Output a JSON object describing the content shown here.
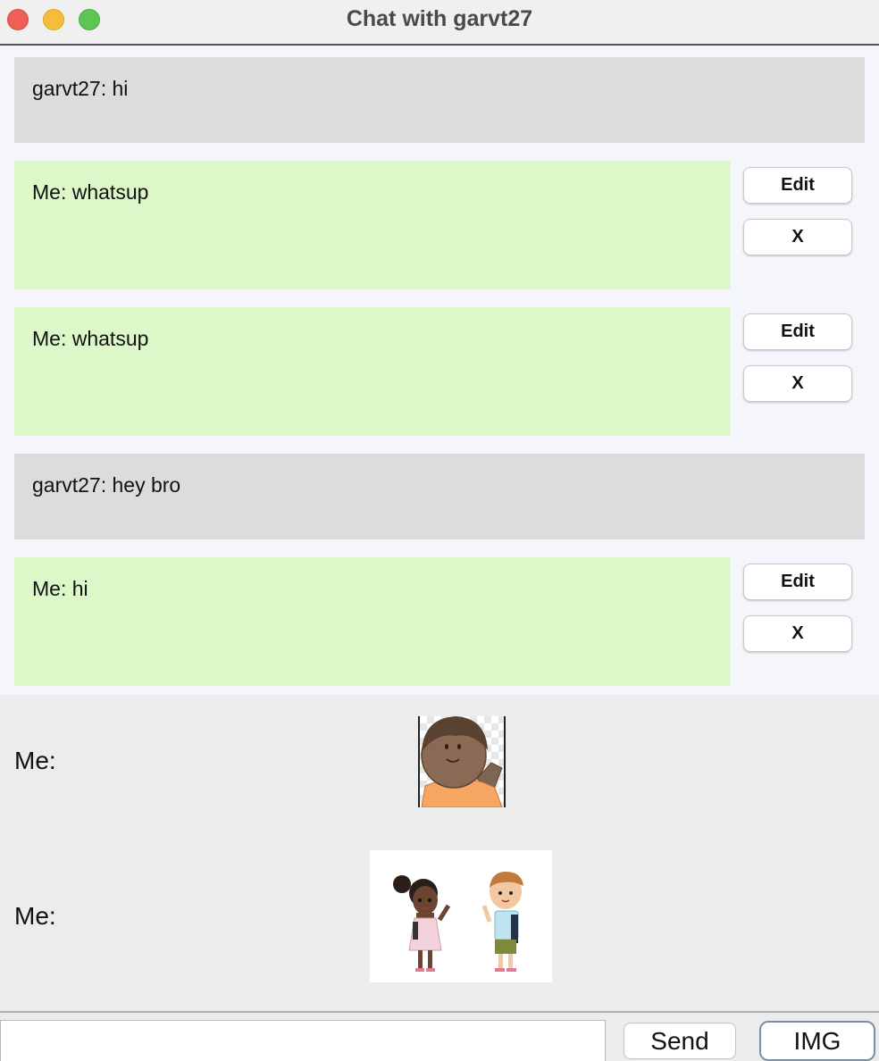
{
  "window": {
    "title": "Chat with garvt27"
  },
  "messages": [
    {
      "kind": "other",
      "text": "garvt27: hi"
    },
    {
      "kind": "me",
      "text": "Me: whatsup",
      "edit_label": "Edit",
      "delete_label": "X"
    },
    {
      "kind": "me",
      "text": "Me: whatsup",
      "edit_label": "Edit",
      "delete_label": "X"
    },
    {
      "kind": "other",
      "text": "garvt27: hey bro"
    },
    {
      "kind": "me",
      "text": "Me: hi",
      "edit_label": "Edit",
      "delete_label": "X"
    }
  ],
  "image_messages": [
    {
      "label": "Me:",
      "image": "waving-boy-illustration"
    },
    {
      "label": "Me:",
      "image": "two-kids-waving-illustration"
    }
  ],
  "composer": {
    "value": "",
    "placeholder": "",
    "send_label": "Send",
    "img_label": "IMG"
  },
  "colors": {
    "other_bubble": "#dcdcdc",
    "me_bubble": "#dcf8c8",
    "chat_bg": "#f5f6fb"
  }
}
